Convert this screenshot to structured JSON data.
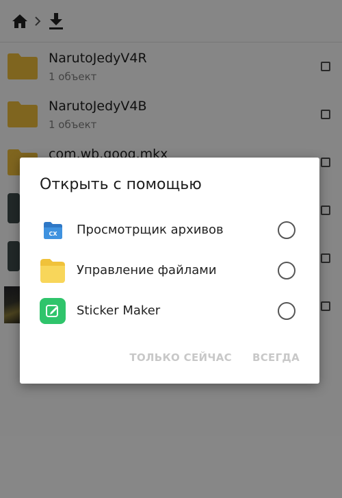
{
  "toolbar": {
    "home_icon": "home-icon",
    "chevron_icon": "chevron-right-icon",
    "download_icon": "download-icon"
  },
  "files": [
    {
      "name": "NarutoJedyV4R",
      "meta": "1 объект",
      "thumb": "folder-icon"
    },
    {
      "name": "NarutoJedyV4B",
      "meta": "1 объект",
      "thumb": "folder-icon"
    },
    {
      "name": "com.wb.goog.mkx",
      "meta": "",
      "thumb": "folder-icon"
    }
  ],
  "dialog": {
    "title": "Открыть с помощью",
    "options": [
      {
        "label": "Просмотрщик архивов",
        "icon": "archive-viewer-icon",
        "color": "#2f78c6"
      },
      {
        "label": "Управление файлами",
        "icon": "file-manager-icon",
        "color": "#f6cf47"
      },
      {
        "label": "Sticker Maker",
        "icon": "sticker-maker-icon",
        "color": "#2fc46b"
      }
    ],
    "once_label": "ТОЛЬКО СЕЙЧАС",
    "always_label": "ВСЕГДА"
  },
  "colors": {
    "folder": "#e8b83a",
    "scrim": "rgba(0,0,0,0.45)"
  }
}
